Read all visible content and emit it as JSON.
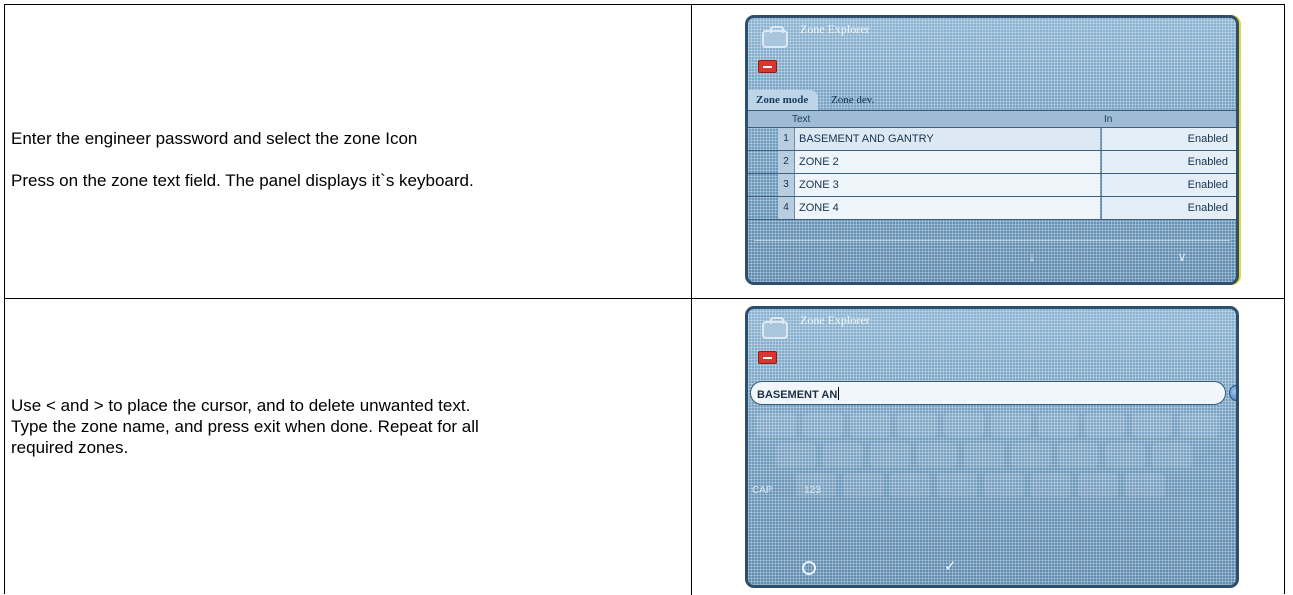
{
  "instructions": {
    "row1": {
      "line1": "Enter the engineer password and select the zone Icon",
      "line2": "Press on the zone text field. The panel displays it`s keyboard."
    },
    "row2": {
      "line1": "Use < and >  to place the cursor, and  to delete unwanted text.",
      "line2": "Type the zone name, and press exit when done. Repeat for all",
      "line3": "required zones."
    }
  },
  "screen1": {
    "window_title": "Zone Explorer",
    "tabs": [
      "Zone mode",
      "Zone dev."
    ],
    "columns": {
      "text": "Text",
      "in": "In"
    },
    "zones": [
      {
        "num": "1",
        "name": "BASEMENT AND GANTRY",
        "status": "Enabled"
      },
      {
        "num": "2",
        "name": "ZONE 2",
        "status": "Enabled"
      },
      {
        "num": "3",
        "name": "ZONE 3",
        "status": "Enabled"
      },
      {
        "num": "4",
        "name": "ZONE 4",
        "status": "Enabled"
      }
    ],
    "nav": {
      "down_icon": "↓",
      "chevron_icon": "∨"
    }
  },
  "screen2": {
    "window_title": "Zone Explorer",
    "text_field_value": "BASEMENT AN",
    "keyboard": {
      "cap_label": "CAP",
      "num_label": "123"
    }
  },
  "colors": {
    "screen_blue": "#7ea7c6",
    "screen_border": "#2e4f6c",
    "accent_yellow": "#e8d63a",
    "red_button": "#d8372f"
  }
}
